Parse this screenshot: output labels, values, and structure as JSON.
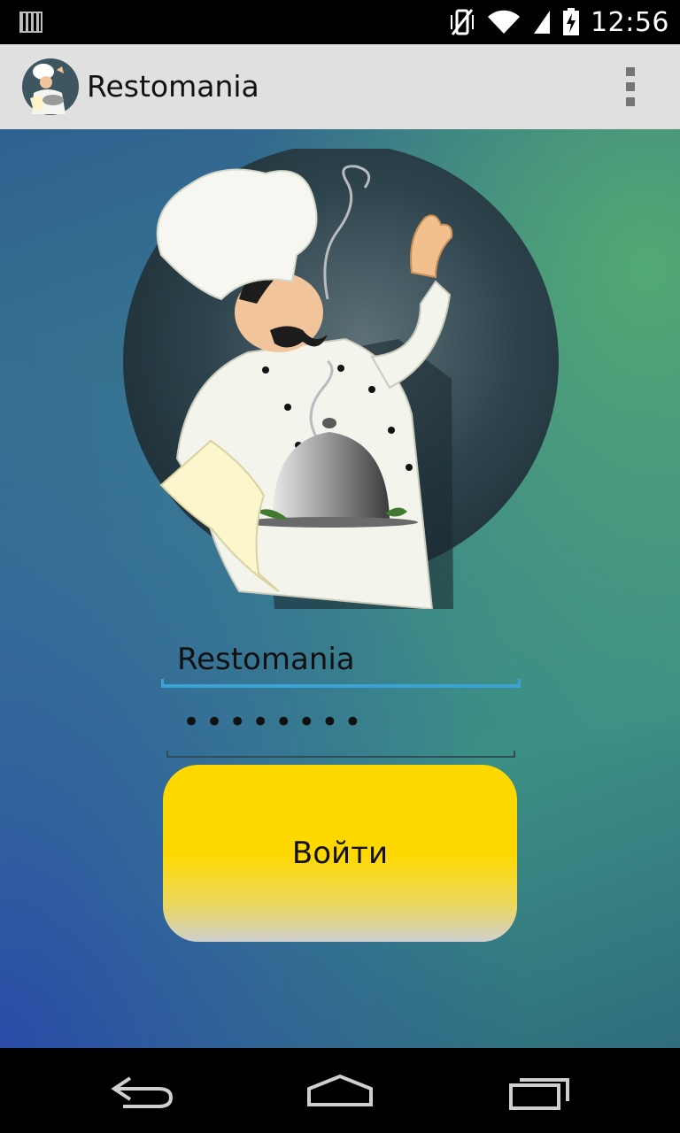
{
  "status_bar": {
    "time": "12:56",
    "icons": [
      "notification-icon",
      "vibrate-icon",
      "wifi-icon",
      "signal-icon",
      "battery-charging-icon"
    ]
  },
  "action_bar": {
    "title": "Restomania",
    "app_icon": "chef-icon",
    "menu_icon": "overflow-menu-icon"
  },
  "illustration": {
    "icon": "chef-illustration"
  },
  "login_form": {
    "login_value": "Restomania",
    "password_value": "••••••••",
    "submit_label": "Войти"
  },
  "nav_bar": {
    "icons": [
      "back-icon",
      "home-icon",
      "recent-apps-icon"
    ]
  },
  "colors": {
    "action_bar_bg": "#e0e0e0",
    "button_yellow": "#ffd800",
    "field_accent": "#3aa2d4"
  }
}
